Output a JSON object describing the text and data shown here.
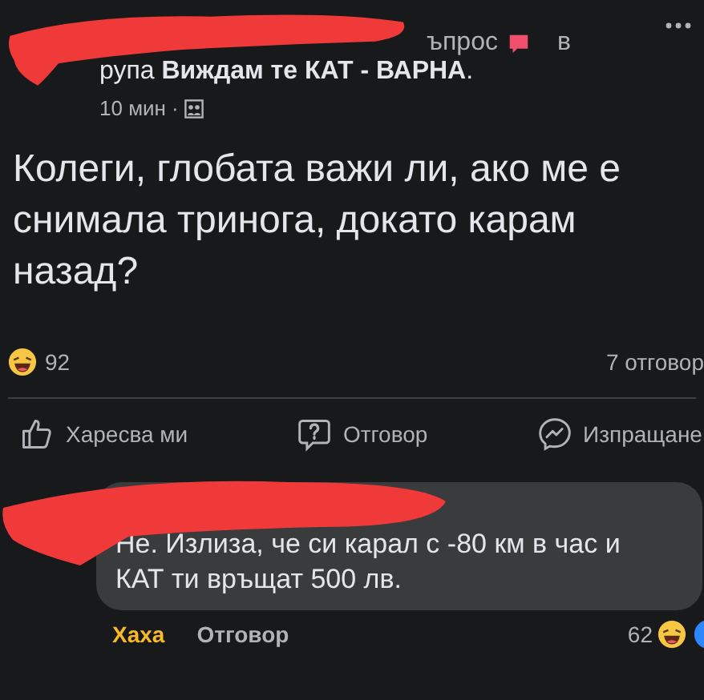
{
  "post": {
    "header_line": "ъпрос",
    "header_in": "в",
    "group_line": "рупа **Виждам те КАТ - ВАРНА**.",
    "time": "10 мин ·",
    "text": "Колеги, глобата важи ли, ако ме е снимала тринога, докато карам назад?",
    "reaction_count": "92",
    "comments_count": "7 отговор",
    "actions": [
      {
        "kind": "like",
        "label": "Харесва ми"
      },
      {
        "kind": "answer",
        "label": "Отговор"
      },
      {
        "kind": "send",
        "label": "Изпращане"
      }
    ]
  },
  "comment": {
    "text": "Не. Излиза, че си карал с -80 км в час и КАТ ти връщат 500 лв.",
    "actions": [
      {
        "label": "Хаха",
        "selected": true
      },
      {
        "label": "Отговор",
        "selected": false
      }
    ],
    "reaction_count": "62"
  }
}
